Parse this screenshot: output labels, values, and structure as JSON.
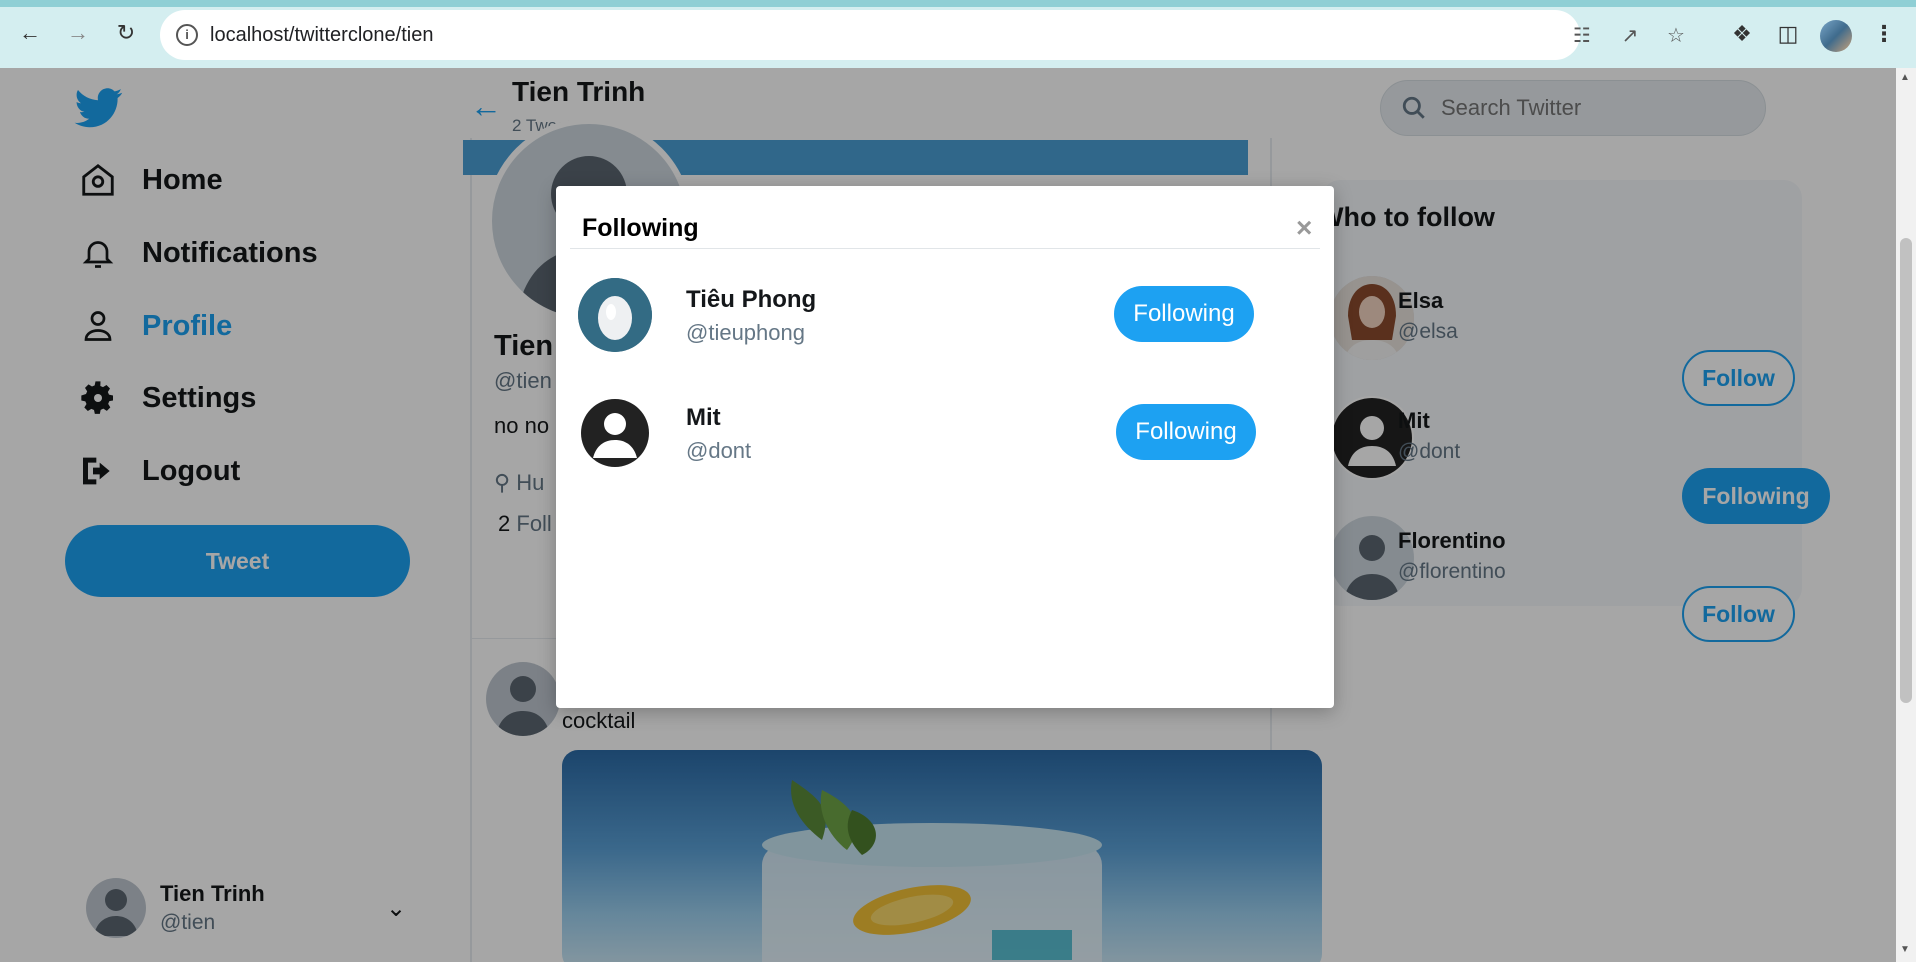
{
  "browser": {
    "url": "localhost/twitterclone/tien"
  },
  "sidebar": {
    "items": [
      {
        "label": "Home",
        "icon": "home-icon"
      },
      {
        "label": "Notifications",
        "icon": "bell-icon"
      },
      {
        "label": "Profile",
        "icon": "user-icon",
        "active": true
      },
      {
        "label": "Settings",
        "icon": "gear-icon"
      },
      {
        "label": "Logout",
        "icon": "logout-icon"
      }
    ],
    "tweet_button": "Tweet",
    "account": {
      "name": "Tien Trinh",
      "handle": "@tien"
    }
  },
  "profile": {
    "header_title": "Tien Trinh",
    "tweet_count": "2 Tweets",
    "name": "Tien",
    "handle": "@tien",
    "bio": "no no",
    "location": "Hu",
    "following_count": "2",
    "following_label": "Foll"
  },
  "tweet": {
    "text": "cocktail"
  },
  "right": {
    "search_placeholder": "Search Twitter",
    "who_to_follow_title": "Who to follow",
    "suggestions": [
      {
        "name": "Elsa",
        "handle": "@elsa",
        "button": "Follow"
      },
      {
        "name": "Mit",
        "handle": "@dont",
        "button": "Following"
      },
      {
        "name": "Florentino",
        "handle": "@florentino",
        "button": "Follow"
      }
    ]
  },
  "modal": {
    "title": "Following",
    "close": "×",
    "users": [
      {
        "name": "Tiêu Phong",
        "handle": "@tieuphong",
        "button": "Following"
      },
      {
        "name": "Mit",
        "handle": "@dont",
        "button": "Following"
      }
    ]
  },
  "colors": {
    "accent": "#1da1f2",
    "chrome": "#d4eef0",
    "overlay": "rgba(0,0,0,0.35)"
  }
}
